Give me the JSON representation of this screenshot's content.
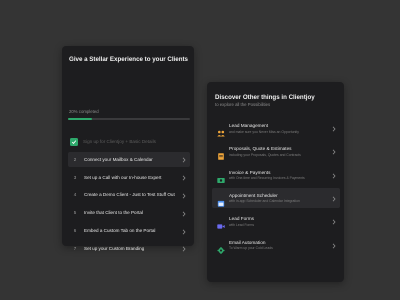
{
  "onboarding": {
    "title": "Give a Stellar Experience to your Clients",
    "progress_text": "20% completed",
    "progress": 0.2,
    "progress_color": "#2ea86b",
    "steps": [
      {
        "num": "",
        "label": "Sign up for Clientjoy + Basic Details",
        "done": true
      },
      {
        "num": "2",
        "label": "Connect your Mailbox & Calendar",
        "done": false,
        "active": true
      },
      {
        "num": "3",
        "label": "Set up a Call with our In-house Expert",
        "done": false
      },
      {
        "num": "4",
        "label": "Create a Demo Client - Just to Test Stuff Out",
        "done": false
      },
      {
        "num": "5",
        "label": "Invite that Client to the Portal",
        "done": false
      },
      {
        "num": "6",
        "label": "Embed a Custom Tab on the Portal",
        "done": false
      },
      {
        "num": "7",
        "label": "Set up your Custom Branding",
        "done": false
      }
    ]
  },
  "discover": {
    "title": "Discover Other things in Clientjoy",
    "subtitle": "to explore all the Possibilities",
    "items": [
      {
        "title": "Lead Management",
        "desc": "and make sure you Never Miss an Opportunity",
        "icon": "people-icon",
        "color": "#f0a63a"
      },
      {
        "title": "Proposals, Quote & Estimates",
        "desc": "including your Proposals, Quotes and Contracts",
        "icon": "document-icon",
        "color": "#f0a63a"
      },
      {
        "title": "Invoice & Payments",
        "desc": "with One-time and Recurring Invoices & Payments",
        "icon": "money-icon",
        "color": "#2ea86b"
      },
      {
        "title": "Appointment Scheduler",
        "desc": "with in-app Scheduler and Calendar Integration",
        "icon": "calendar-icon",
        "color": "#4a8ff0",
        "active": true
      },
      {
        "title": "Lead Forms",
        "desc": "with Lead Forms",
        "icon": "video-icon",
        "color": "#6b6bf0"
      },
      {
        "title": "Email Automation",
        "desc": "To Warm up your Cold Leads",
        "icon": "gear-icon",
        "color": "#2ea86b"
      }
    ]
  }
}
